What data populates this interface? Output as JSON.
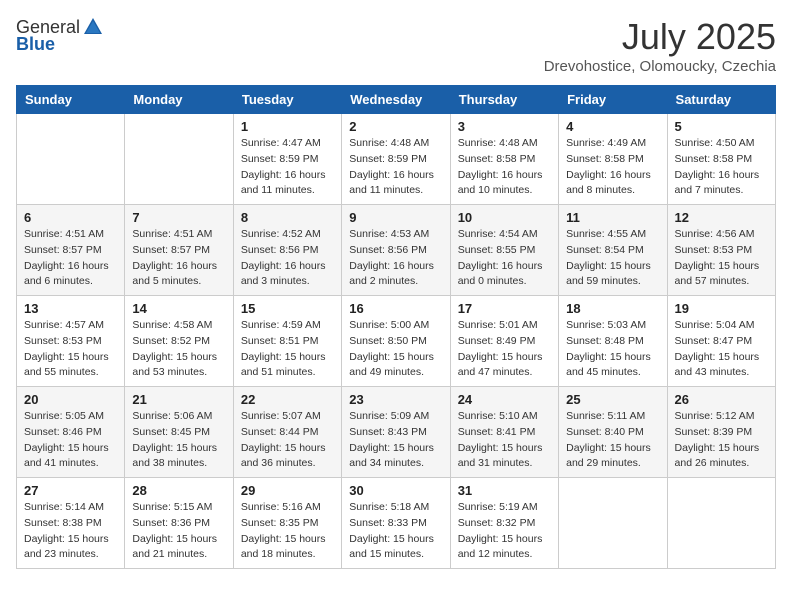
{
  "header": {
    "logo_general": "General",
    "logo_blue": "Blue",
    "month": "July 2025",
    "location": "Drevohostice, Olomoucky, Czechia"
  },
  "weekdays": [
    "Sunday",
    "Monday",
    "Tuesday",
    "Wednesday",
    "Thursday",
    "Friday",
    "Saturday"
  ],
  "weeks": [
    [
      {
        "day": "",
        "sunrise": "",
        "sunset": "",
        "daylight": ""
      },
      {
        "day": "",
        "sunrise": "",
        "sunset": "",
        "daylight": ""
      },
      {
        "day": "1",
        "sunrise": "Sunrise: 4:47 AM",
        "sunset": "Sunset: 8:59 PM",
        "daylight": "Daylight: 16 hours and 11 minutes."
      },
      {
        "day": "2",
        "sunrise": "Sunrise: 4:48 AM",
        "sunset": "Sunset: 8:59 PM",
        "daylight": "Daylight: 16 hours and 11 minutes."
      },
      {
        "day": "3",
        "sunrise": "Sunrise: 4:48 AM",
        "sunset": "Sunset: 8:58 PM",
        "daylight": "Daylight: 16 hours and 10 minutes."
      },
      {
        "day": "4",
        "sunrise": "Sunrise: 4:49 AM",
        "sunset": "Sunset: 8:58 PM",
        "daylight": "Daylight: 16 hours and 8 minutes."
      },
      {
        "day": "5",
        "sunrise": "Sunrise: 4:50 AM",
        "sunset": "Sunset: 8:58 PM",
        "daylight": "Daylight: 16 hours and 7 minutes."
      }
    ],
    [
      {
        "day": "6",
        "sunrise": "Sunrise: 4:51 AM",
        "sunset": "Sunset: 8:57 PM",
        "daylight": "Daylight: 16 hours and 6 minutes."
      },
      {
        "day": "7",
        "sunrise": "Sunrise: 4:51 AM",
        "sunset": "Sunset: 8:57 PM",
        "daylight": "Daylight: 16 hours and 5 minutes."
      },
      {
        "day": "8",
        "sunrise": "Sunrise: 4:52 AM",
        "sunset": "Sunset: 8:56 PM",
        "daylight": "Daylight: 16 hours and 3 minutes."
      },
      {
        "day": "9",
        "sunrise": "Sunrise: 4:53 AM",
        "sunset": "Sunset: 8:56 PM",
        "daylight": "Daylight: 16 hours and 2 minutes."
      },
      {
        "day": "10",
        "sunrise": "Sunrise: 4:54 AM",
        "sunset": "Sunset: 8:55 PM",
        "daylight": "Daylight: 16 hours and 0 minutes."
      },
      {
        "day": "11",
        "sunrise": "Sunrise: 4:55 AM",
        "sunset": "Sunset: 8:54 PM",
        "daylight": "Daylight: 15 hours and 59 minutes."
      },
      {
        "day": "12",
        "sunrise": "Sunrise: 4:56 AM",
        "sunset": "Sunset: 8:53 PM",
        "daylight": "Daylight: 15 hours and 57 minutes."
      }
    ],
    [
      {
        "day": "13",
        "sunrise": "Sunrise: 4:57 AM",
        "sunset": "Sunset: 8:53 PM",
        "daylight": "Daylight: 15 hours and 55 minutes."
      },
      {
        "day": "14",
        "sunrise": "Sunrise: 4:58 AM",
        "sunset": "Sunset: 8:52 PM",
        "daylight": "Daylight: 15 hours and 53 minutes."
      },
      {
        "day": "15",
        "sunrise": "Sunrise: 4:59 AM",
        "sunset": "Sunset: 8:51 PM",
        "daylight": "Daylight: 15 hours and 51 minutes."
      },
      {
        "day": "16",
        "sunrise": "Sunrise: 5:00 AM",
        "sunset": "Sunset: 8:50 PM",
        "daylight": "Daylight: 15 hours and 49 minutes."
      },
      {
        "day": "17",
        "sunrise": "Sunrise: 5:01 AM",
        "sunset": "Sunset: 8:49 PM",
        "daylight": "Daylight: 15 hours and 47 minutes."
      },
      {
        "day": "18",
        "sunrise": "Sunrise: 5:03 AM",
        "sunset": "Sunset: 8:48 PM",
        "daylight": "Daylight: 15 hours and 45 minutes."
      },
      {
        "day": "19",
        "sunrise": "Sunrise: 5:04 AM",
        "sunset": "Sunset: 8:47 PM",
        "daylight": "Daylight: 15 hours and 43 minutes."
      }
    ],
    [
      {
        "day": "20",
        "sunrise": "Sunrise: 5:05 AM",
        "sunset": "Sunset: 8:46 PM",
        "daylight": "Daylight: 15 hours and 41 minutes."
      },
      {
        "day": "21",
        "sunrise": "Sunrise: 5:06 AM",
        "sunset": "Sunset: 8:45 PM",
        "daylight": "Daylight: 15 hours and 38 minutes."
      },
      {
        "day": "22",
        "sunrise": "Sunrise: 5:07 AM",
        "sunset": "Sunset: 8:44 PM",
        "daylight": "Daylight: 15 hours and 36 minutes."
      },
      {
        "day": "23",
        "sunrise": "Sunrise: 5:09 AM",
        "sunset": "Sunset: 8:43 PM",
        "daylight": "Daylight: 15 hours and 34 minutes."
      },
      {
        "day": "24",
        "sunrise": "Sunrise: 5:10 AM",
        "sunset": "Sunset: 8:41 PM",
        "daylight": "Daylight: 15 hours and 31 minutes."
      },
      {
        "day": "25",
        "sunrise": "Sunrise: 5:11 AM",
        "sunset": "Sunset: 8:40 PM",
        "daylight": "Daylight: 15 hours and 29 minutes."
      },
      {
        "day": "26",
        "sunrise": "Sunrise: 5:12 AM",
        "sunset": "Sunset: 8:39 PM",
        "daylight": "Daylight: 15 hours and 26 minutes."
      }
    ],
    [
      {
        "day": "27",
        "sunrise": "Sunrise: 5:14 AM",
        "sunset": "Sunset: 8:38 PM",
        "daylight": "Daylight: 15 hours and 23 minutes."
      },
      {
        "day": "28",
        "sunrise": "Sunrise: 5:15 AM",
        "sunset": "Sunset: 8:36 PM",
        "daylight": "Daylight: 15 hours and 21 minutes."
      },
      {
        "day": "29",
        "sunrise": "Sunrise: 5:16 AM",
        "sunset": "Sunset: 8:35 PM",
        "daylight": "Daylight: 15 hours and 18 minutes."
      },
      {
        "day": "30",
        "sunrise": "Sunrise: 5:18 AM",
        "sunset": "Sunset: 8:33 PM",
        "daylight": "Daylight: 15 hours and 15 minutes."
      },
      {
        "day": "31",
        "sunrise": "Sunrise: 5:19 AM",
        "sunset": "Sunset: 8:32 PM",
        "daylight": "Daylight: 15 hours and 12 minutes."
      },
      {
        "day": "",
        "sunrise": "",
        "sunset": "",
        "daylight": ""
      },
      {
        "day": "",
        "sunrise": "",
        "sunset": "",
        "daylight": ""
      }
    ]
  ]
}
